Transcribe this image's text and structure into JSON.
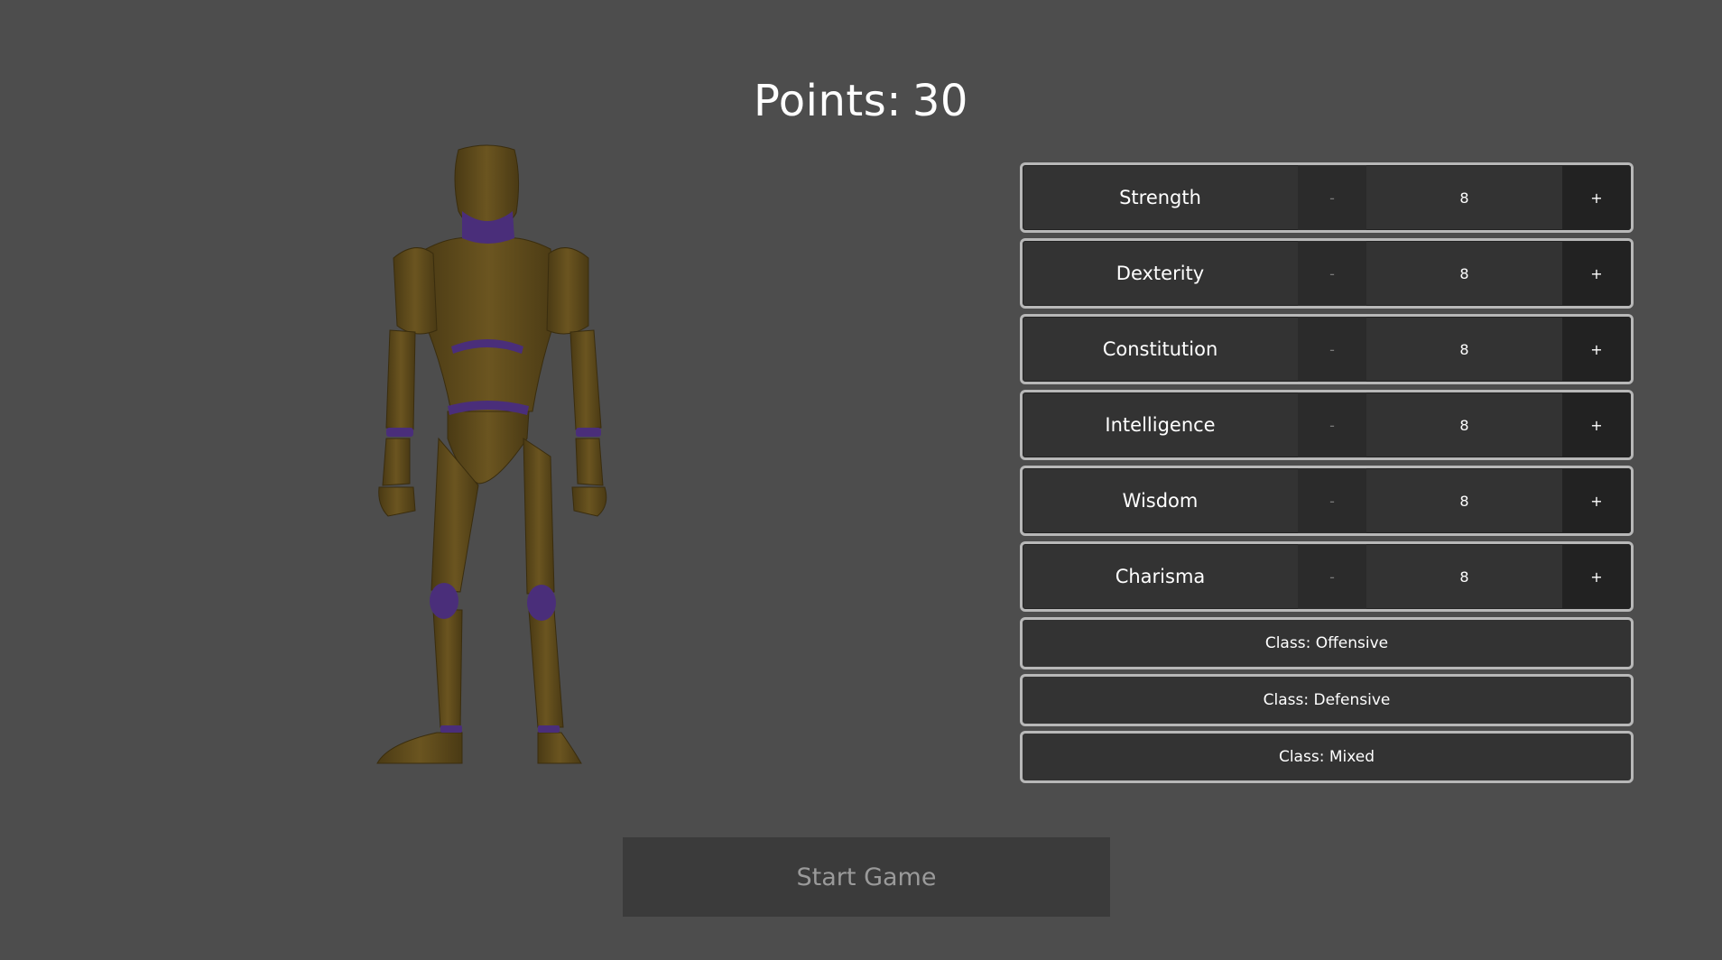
{
  "header": {
    "points_label": "Points:",
    "points_value": "30"
  },
  "stats": [
    {
      "name": "Strength",
      "value": "8"
    },
    {
      "name": "Dexterity",
      "value": "8"
    },
    {
      "name": "Constitution",
      "value": "8"
    },
    {
      "name": "Intelligence",
      "value": "8"
    },
    {
      "name": "Wisdom",
      "value": "8"
    },
    {
      "name": "Charisma",
      "value": "8"
    }
  ],
  "controls": {
    "minus": "-",
    "plus": "+"
  },
  "classes": [
    {
      "label": "Class: Offensive"
    },
    {
      "label": "Class: Defensive"
    },
    {
      "label": "Class: Mixed"
    }
  ],
  "start_button": "Start Game",
  "colors": {
    "background": "#4d4d4d",
    "panel": "#333333",
    "border": "#b8b8b8",
    "figure_body": "#5c4a1e",
    "figure_joint": "#4a2e7a"
  },
  "icons": {
    "character": "mannequin-figure"
  }
}
